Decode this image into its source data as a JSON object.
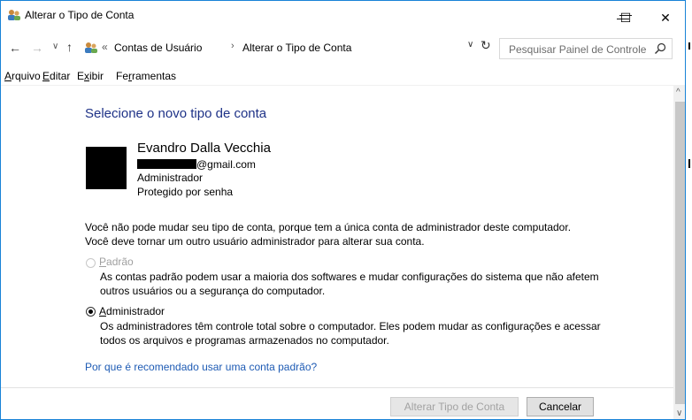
{
  "window": {
    "title": "Alterar o Tipo de Conta",
    "controls": {
      "minimize": "—",
      "maximize": "☐",
      "close": "✕"
    }
  },
  "nav": {
    "back": "←",
    "forward": "→",
    "history": "∨",
    "up": "↑",
    "breadcrumb_overflow": "«",
    "breadcrumbs": [
      "Contas de Usuário",
      "Alterar o Tipo de Conta"
    ],
    "separator": "›",
    "dropdown": "∨",
    "refresh": "↻",
    "search_placeholder": "Pesquisar Painel de Controle"
  },
  "menu": {
    "items": [
      {
        "key": "A",
        "rest": "rquivo"
      },
      {
        "key": "E",
        "rest": "ditar"
      },
      {
        "pre": "E",
        "key": "x",
        "rest": "ibir"
      },
      {
        "pre": "Fe",
        "key": "r",
        "rest": "ramentas"
      }
    ]
  },
  "page": {
    "heading": "Selecione o novo tipo de conta",
    "user": {
      "name": "Evandro Dalla Vecchia",
      "email_suffix": "@gmail.com",
      "role": "Administrador",
      "password_status": "Protegido por senha"
    },
    "info_line1": "Você não pode mudar seu tipo de conta, porque tem a única conta de administrador deste computador.",
    "info_line2": "Você deve tornar um outro usuário administrador para alterar sua conta.",
    "options": [
      {
        "label_key": "P",
        "label_rest": "adrão",
        "selected": false,
        "disabled": true,
        "desc1": "As contas padrão podem usar a maioria dos softwares e mudar configurações do sistema que não afetem",
        "desc2": "outros usuários ou a segurança do computador."
      },
      {
        "label_key": "A",
        "label_rest": "dministrador",
        "selected": true,
        "disabled": false,
        "desc1": "Os administradores têm controle total sobre o computador. Eles podem mudar as configurações e acessar",
        "desc2": "todos os arquivos e programas armazenados no computador."
      }
    ],
    "why_link": "Por que é recomendado usar uma conta padrão?"
  },
  "buttons": {
    "change": "Alterar Tipo de Conta",
    "cancel": "Cancelar"
  },
  "scroll": {
    "up": "^",
    "down": "∨"
  },
  "colors": {
    "heading": "#1e3287",
    "link": "#1e5bb4",
    "window_border": "#1883d7"
  }
}
